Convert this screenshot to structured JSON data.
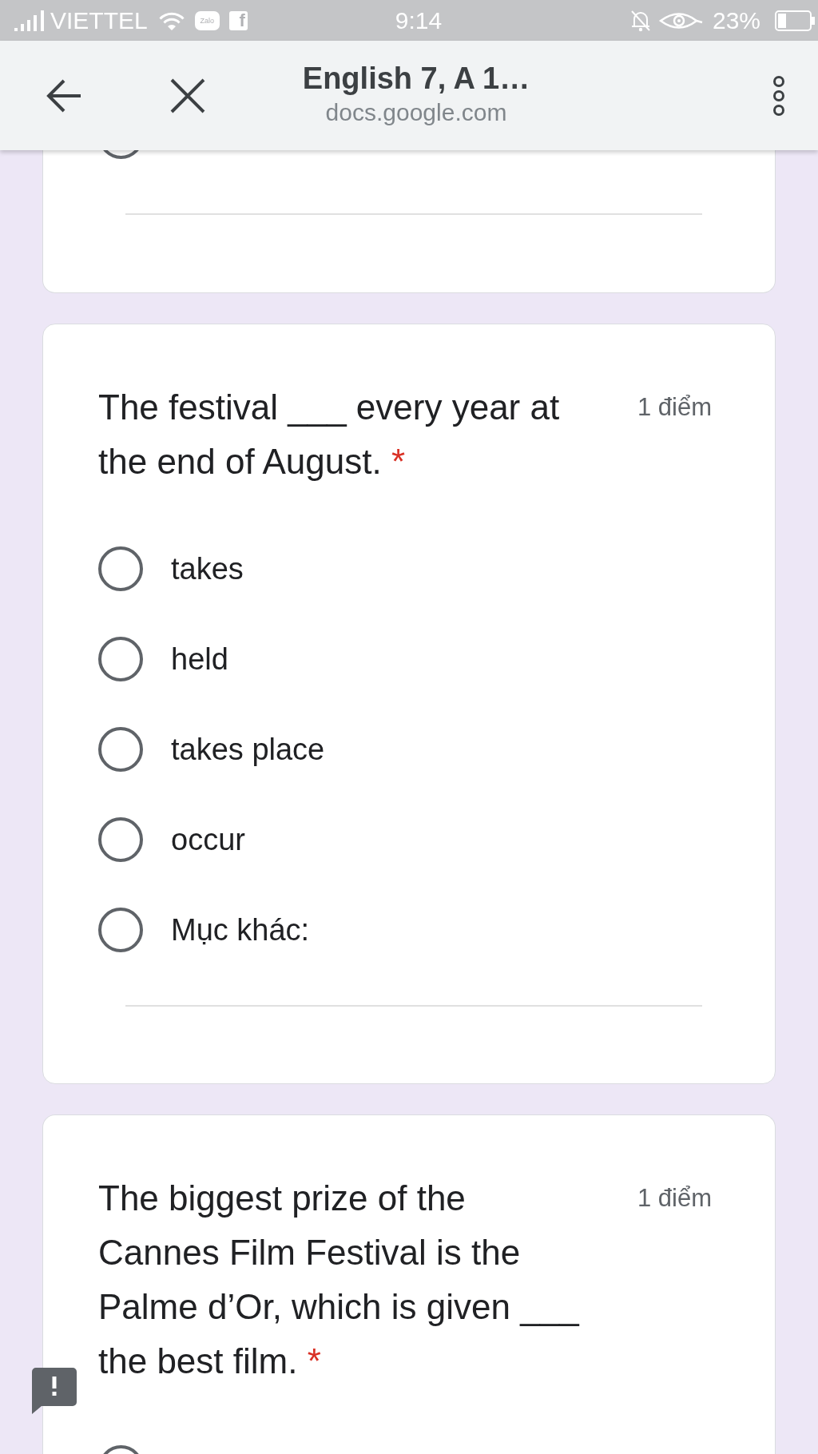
{
  "status_bar": {
    "carrier": "VIETTEL",
    "notifications": [
      {
        "kind": "zalo",
        "label": "Zalo"
      },
      {
        "kind": "facebook",
        "label": "f"
      }
    ],
    "time": "9:14",
    "battery_text": "23%"
  },
  "toolbar": {
    "title": "English 7, A 1…",
    "subtitle": "docs.google.com"
  },
  "cards": [
    {
      "kind": "cut_top",
      "partial_option": {
        "selected": false
      },
      "other_field": true
    },
    {
      "kind": "question",
      "question": "The festival ___ every year at the end of August.",
      "required_mark": "*",
      "points": "1 điểm",
      "options": [
        {
          "kind": "choice",
          "label": "takes",
          "selected": false
        },
        {
          "kind": "choice",
          "label": "held",
          "selected": false
        },
        {
          "kind": "choice",
          "label": "takes place",
          "selected": false
        },
        {
          "kind": "choice",
          "label": "occur",
          "selected": false
        },
        {
          "kind": "other",
          "label": "Mục khác:",
          "selected": false
        }
      ]
    },
    {
      "kind": "cut_bottom",
      "question": "The biggest prize of the Cannes Film Festival is the Palme d’Or, which is given ___ the best film.",
      "required_mark": "*",
      "points": "1 điểm",
      "partial_option": {
        "selected": false
      }
    }
  ]
}
